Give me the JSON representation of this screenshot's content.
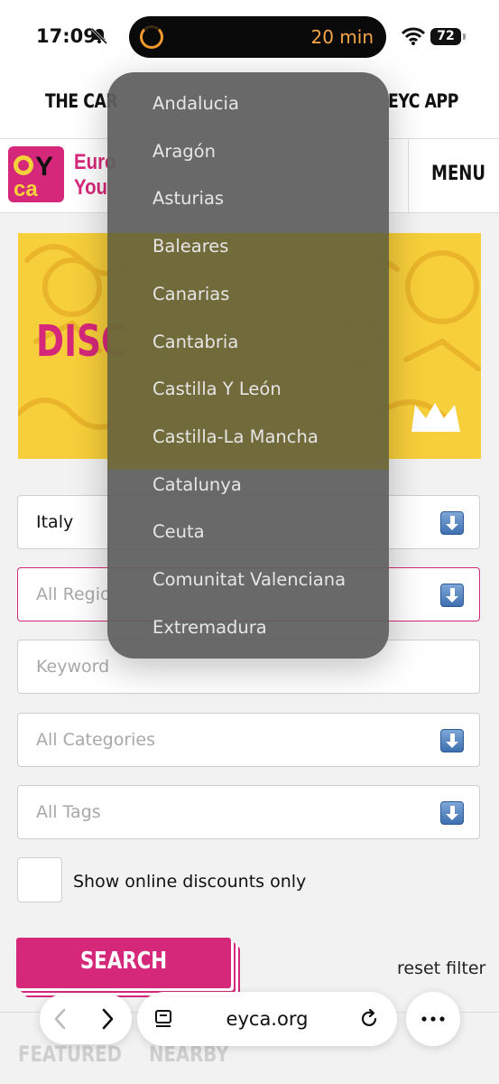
{
  "status_bar": {
    "time": "17:09",
    "timer": "20 min",
    "battery": "72"
  },
  "top_nav": {
    "items": [
      "THE CAR",
      "EYC APP"
    ]
  },
  "header": {
    "brand_line1": "Euro",
    "brand_line2": "You",
    "menu": "MENU"
  },
  "hero": {
    "title": "DISC"
  },
  "form": {
    "country": "Italy",
    "region_placeholder": "All Regio",
    "keyword_placeholder": "Keyword",
    "categories_placeholder": "All Categories",
    "tags_placeholder": "All Tags",
    "online_only_label": "Show online discounts only",
    "search_label": "SEARCH",
    "reset_label": "reset filter"
  },
  "tabs": [
    "FEATURED",
    "NEARBY"
  ],
  "browser": {
    "url": "eyca.org"
  },
  "dropdown": {
    "options": [
      "Andalucia",
      "Aragón",
      "Asturias",
      "Baleares",
      "Canarias",
      "Cantabria",
      "Castilla Y León",
      "Castilla-La Mancha",
      "Catalunya",
      "Ceuta",
      "Comunitat Valenciana",
      "Extremadura"
    ]
  },
  "colors": {
    "brand_pink": "#d6287a",
    "hero_yellow": "#f7cf3a",
    "timer_orange": "#f29a2e"
  },
  "icons": [
    "bell-slash-icon",
    "timer-icon",
    "wifi-icon",
    "battery-icon",
    "dropdown-arrow-icon",
    "back-icon",
    "forward-icon",
    "tabs-icon",
    "reload-icon",
    "more-icon"
  ]
}
